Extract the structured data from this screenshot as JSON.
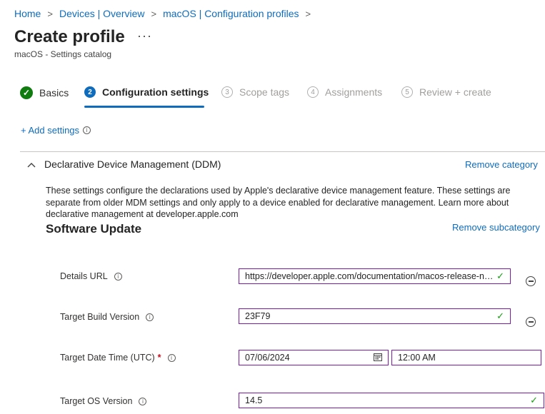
{
  "breadcrumb": [
    {
      "label": "Home"
    },
    {
      "label": "Devices | Overview"
    },
    {
      "label": "macOS | Configuration profiles"
    }
  ],
  "page": {
    "title": "Create profile",
    "more": "···",
    "subtitle": "macOS - Settings catalog"
  },
  "steps": [
    {
      "number": "✓",
      "label": "Basics",
      "state": "done"
    },
    {
      "number": "2",
      "label": "Configuration settings",
      "state": "active"
    },
    {
      "number": "3",
      "label": "Scope tags",
      "state": "inactive"
    },
    {
      "number": "4",
      "label": "Assignments",
      "state": "inactive"
    },
    {
      "number": "5",
      "label": "Review + create",
      "state": "inactive"
    }
  ],
  "add_settings": {
    "label": "+ Add settings",
    "info_icon": "i"
  },
  "category": {
    "chevron": "∧",
    "name": "Declarative Device Management (DDM)",
    "remove_label": "Remove category",
    "description": "These settings configure the declarations used by Apple's declarative device management feature. These settings are separate from older MDM settings and only apply to a device enabled for declarative management. Learn more about declarative management at developer.apple.com"
  },
  "subcategory": {
    "name": "Software Update",
    "remove_label": "Remove subcategory"
  },
  "settings": {
    "details_url": {
      "label": "Details URL",
      "value": "https://developer.apple.com/documentation/macos-release-notes"
    },
    "target_build": {
      "label": "Target Build Version",
      "value": "23F79"
    },
    "target_date": {
      "label": "Target Date Time (UTC)",
      "required_marker": "*",
      "date": "07/06/2024",
      "time": "12:00 AM"
    },
    "target_os": {
      "label": "Target OS Version",
      "value": "14.5"
    }
  },
  "colors": {
    "accent": "#0f6cbd",
    "success": "#107c10",
    "field_border": "#7a1fa2",
    "required": "#c50f1f"
  },
  "icons": {
    "check": "✓",
    "info": "i"
  }
}
